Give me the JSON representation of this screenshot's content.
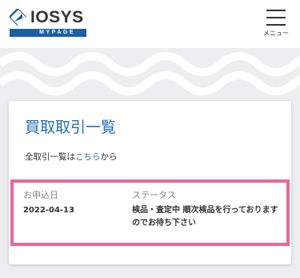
{
  "header": {
    "logo_text": "IOSYS",
    "logo_subtext": "MYPAGE",
    "menu_label": "メニュー"
  },
  "colors": {
    "brand_blue": "#1a5fa6",
    "title_blue": "#1f6fb5",
    "highlight_pink": "#e8679b",
    "background_gray": "#eeeef0"
  },
  "card": {
    "title": "買取取引一覧",
    "sub_prefix": "全取引一覧は",
    "sub_link": "こちら",
    "sub_suffix": "から",
    "table": {
      "headers": {
        "date": "お申込日",
        "status": "ステータス"
      },
      "rows": [
        {
          "date": "2022-04-13",
          "status": "検品・査定中 順次検品を行っておりますのでお待ち下さい"
        }
      ]
    }
  }
}
